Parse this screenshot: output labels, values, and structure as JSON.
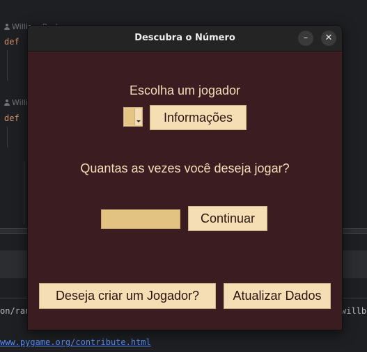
{
  "background_ide": {
    "author_1": "William Barbosa",
    "author_2": "William",
    "def_keyword": "def",
    "console_left": "on/ran",
    "console_right": "willb",
    "link": "www.pygame.org/contribute.html"
  },
  "window": {
    "title": "Descubra o Número",
    "minimize_glyph": "–",
    "close_glyph": "✕"
  },
  "player": {
    "label": "Escolha um jogador",
    "selected": "",
    "info_button": "Informações"
  },
  "rounds": {
    "question": "Quantas as vezes você deseja jogar?",
    "input_value": "",
    "continue_button": "Continuar"
  },
  "footer": {
    "create_player_button": "Deseja criar um Jogador?",
    "update_button": "Atualizar Dados"
  },
  "colors": {
    "window_bg": "#3b1d21",
    "button_bg": "#f5deb3",
    "label_text": "#f3dfb9",
    "titlebar_bg": "#242424"
  }
}
